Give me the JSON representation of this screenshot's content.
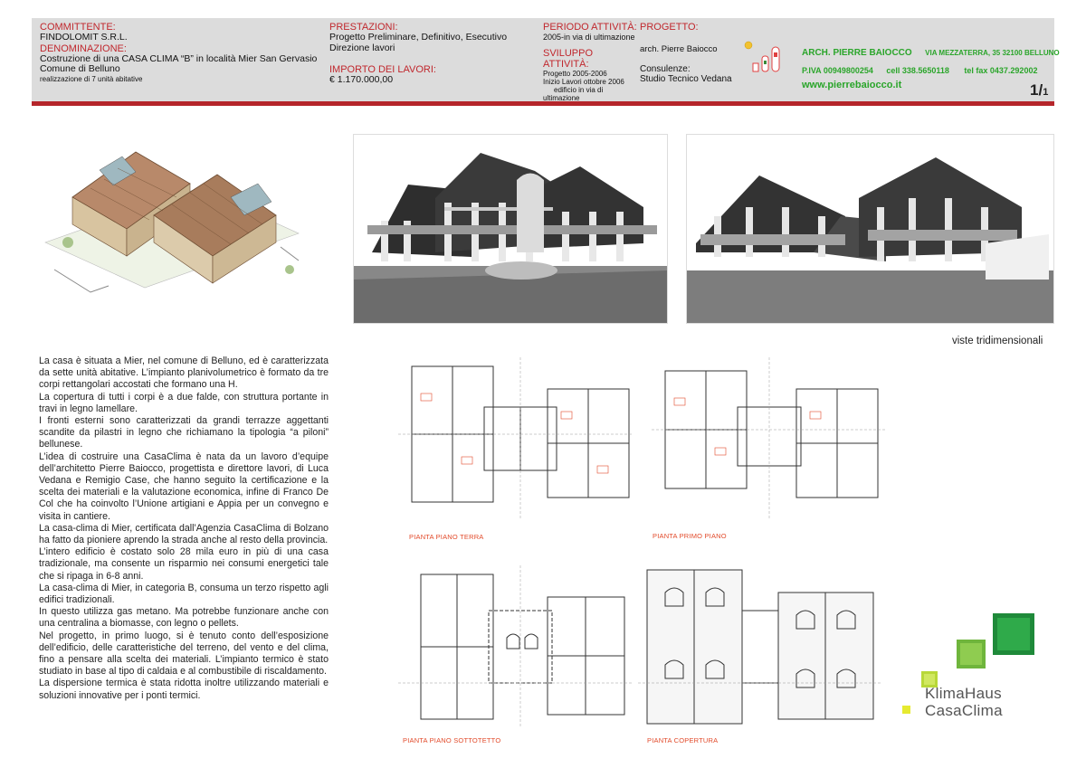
{
  "header": {
    "committente_label": "COMMITTENTE:",
    "committente": "FINDOLOMIT S.R.L.",
    "denominazione_label": "DENOMINAZIONE:",
    "denominazione_1": "Costruzione di una CASA CLIMA “B” in località Mier San Gervasio",
    "denominazione_2": "Comune di Belluno",
    "denominazione_3": "realizzazione di 7 unità abitative",
    "prestazioni_label": "PRESTAZIONI:",
    "prestazioni_1": "Progetto Preliminare, Definitivo, Esecutivo",
    "prestazioni_2": "Direzione lavori",
    "importo_label": "IMPORTO DEI LAVORI:",
    "importo": "€ 1.170.000,00",
    "periodo_label": "PERIODO ATTIVITÀ:",
    "periodo": "2005-in via di ultimazione",
    "sviluppo_label": "SVILUPPO ATTIVITÀ:",
    "sviluppo_1": "Progetto 2005-2006",
    "sviluppo_2": "Inizio Lavori ottobre 2006",
    "sviluppo_3": "edificio in via di",
    "sviluppo_4": "ultimazione",
    "progetto_label": "PROGETTO:",
    "progetto": "arch. Pierre Baiocco",
    "consulenze_label": "Consulenze:",
    "consulenze": "Studio Tecnico Vedana",
    "studio_name": "ARCH.  PIERRE BAIOCCO",
    "studio_address": "VIA MEZZATERRA, 35 32100 BELLUNO",
    "studio_piva": "P.IVA  00949800254",
    "studio_cell": "cell  338.5650118",
    "studio_tel": "tel fax  0437.292002",
    "studio_web": "www.pierrebaiocco.it",
    "page_number": "1/",
    "page_total": "1"
  },
  "captions": {
    "viste": "viste tridimensionali",
    "plan_terra": "PIANTA PIANO TERRA",
    "plan_primo": "PIANTA PRIMO PIANO",
    "plan_sottotetto": "PIANTA PIANO SOTTOTETTO",
    "plan_copertura": "PIANTA COPERTURA"
  },
  "logo": {
    "klimahaus": "KlimaHaus",
    "casaclima": "CasaClima"
  },
  "body_paragraphs": [
    "La casa è situata a Mier, nel comune di Belluno, ed è caratterizzata da sette unità abitative. L’impianto planivolumetrico è formato da tre corpi rettangolari accostati che formano una H.",
    "La copertura di tutti i corpi è a due falde, con struttura portante in travi in legno lamellare.",
    "I fronti esterni sono caratterizzati da grandi terrazze aggettanti scandite da pilastri in legno che richiamano la tipologia “a piloni” bellunese.",
    "L’idea di costruire una CasaClima è nata da un lavoro d’equipe dell’architetto Pierre Baiocco, progettista e direttore lavori, di Luca Vedana e Remigio Case, che hanno seguito la certificazione e la scelta dei materiali e la valutazione economica, infine di Franco De Col che ha coinvolto l’Unione artigiani e Appia per un convegno e visita in cantiere.",
    "La casa-clima di Mier, certificata dall’Agenzia CasaClima di Bolzano ha fatto da pioniere aprendo la strada anche al resto della provincia.",
    "L’intero edificio è costato solo 28 mila euro in più di una casa tradizionale, ma consente un risparmio nei consumi energetici tale che si ripaga in 6-8 anni.",
    "La casa-clima di Mier, in categoria B, consuma un terzo rispetto agli edifici tradizionali.",
    "In questo utilizza gas metano. Ma potrebbe funzionare anche con una centralina a biomasse, con legno o pellets.",
    "Nel progetto, in primo luogo, si è tenuto conto dell’esposizione dell’edificio, delle caratteristiche del terreno, del vento e del clima, fino a pensare alla scelta dei materiali. L’impianto termico è stato studiato in base al tipo di caldaia e al combustibile di riscaldamento.",
    "La dispersione termica è stata ridotta inoltre utilizzando materiali e soluzioni innovative per i ponti termici."
  ],
  "colors": {
    "accent_red": "#c0272d",
    "studio_green": "#2aa52a",
    "header_bg": "#dcdcdc"
  }
}
